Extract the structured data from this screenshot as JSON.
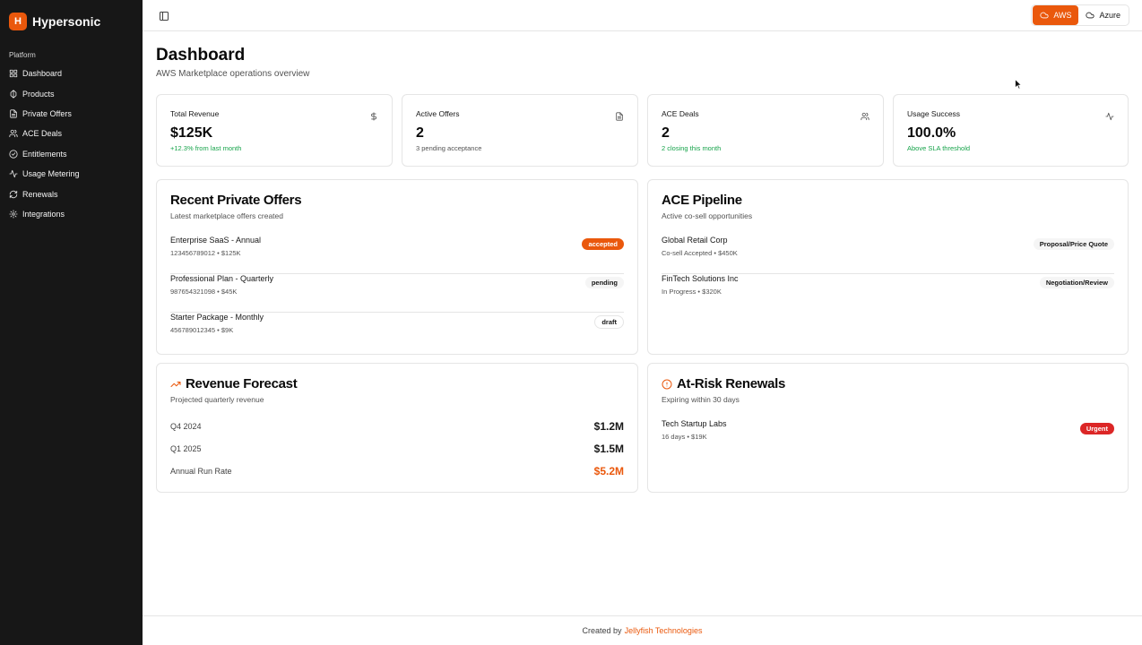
{
  "app": {
    "logo_letter": "H",
    "name": "Hypersonic"
  },
  "sidebar": {
    "section_label": "Platform",
    "items": [
      {
        "label": "Dashboard",
        "icon": "grid-icon"
      },
      {
        "label": "Products",
        "icon": "package-icon"
      },
      {
        "label": "Private Offers",
        "icon": "document-icon"
      },
      {
        "label": "ACE Deals",
        "icon": "users-icon"
      },
      {
        "label": "Entitlements",
        "icon": "check-circle-icon"
      },
      {
        "label": "Usage Metering",
        "icon": "activity-icon"
      },
      {
        "label": "Renewals",
        "icon": "refresh-icon"
      },
      {
        "label": "Integrations",
        "icon": "gear-icon"
      }
    ]
  },
  "topbar": {
    "cloud_options": [
      {
        "label": "AWS",
        "active": true
      },
      {
        "label": "Azure",
        "active": false
      }
    ]
  },
  "page": {
    "title": "Dashboard",
    "subtitle": "AWS Marketplace operations overview"
  },
  "stats": [
    {
      "label": "Total Revenue",
      "value": "$125K",
      "note": "+12.3% from last month",
      "icon": "dollar-icon"
    },
    {
      "label": "Active Offers",
      "value": "2",
      "note": "3 pending acceptance",
      "icon": "document-icon"
    },
    {
      "label": "ACE Deals",
      "value": "2",
      "note": "2 closing this month",
      "icon": "users-icon"
    },
    {
      "label": "Usage Success",
      "value": "100.0%",
      "note": "Above SLA threshold",
      "icon": "activity-icon"
    }
  ],
  "recent_offers": {
    "title": "Recent Private Offers",
    "subtitle": "Latest marketplace offers created",
    "rows": [
      {
        "title": "Enterprise SaaS - Annual",
        "meta": "123456789012 • $125K",
        "status": "accepted"
      },
      {
        "title": "Professional Plan - Quarterly",
        "meta": "987654321098 • $45K",
        "status": "pending"
      },
      {
        "title": "Starter Package - Monthly",
        "meta": "456789012345 • $9K",
        "status": "draft"
      }
    ]
  },
  "ace_pipeline": {
    "title": "ACE Pipeline",
    "subtitle": "Active co-sell opportunities",
    "rows": [
      {
        "title": "Global Retail Corp",
        "meta": "Co-sell Accepted • $450K",
        "stage": "Proposal/Price Quote"
      },
      {
        "title": "FinTech Solutions Inc",
        "meta": "In Progress • $320K",
        "stage": "Negotiation/Review"
      }
    ]
  },
  "revenue_forecast": {
    "title": "Revenue Forecast",
    "subtitle": "Projected quarterly revenue",
    "icon": "trending-up-icon",
    "rows": [
      {
        "label": "Q4 2024",
        "value": "$1.2M"
      },
      {
        "label": "Q1 2025",
        "value": "$1.5M"
      },
      {
        "label": "Annual Run Rate",
        "value": "$5.2M"
      }
    ]
  },
  "at_risk": {
    "title": "At-Risk Renewals",
    "subtitle": "Expiring within 30 days",
    "icon": "alert-circle-icon",
    "rows": [
      {
        "title": "Tech Startup Labs",
        "meta": "16 days • $19K",
        "badge": "Urgent"
      }
    ]
  },
  "footer": {
    "prefix": "Created by",
    "link": "Jellyfish Technologies"
  },
  "colors": {
    "accent": "#ea580c",
    "sidebar_bg": "#171717",
    "positive": "#16a34a",
    "danger": "#dc2626"
  }
}
